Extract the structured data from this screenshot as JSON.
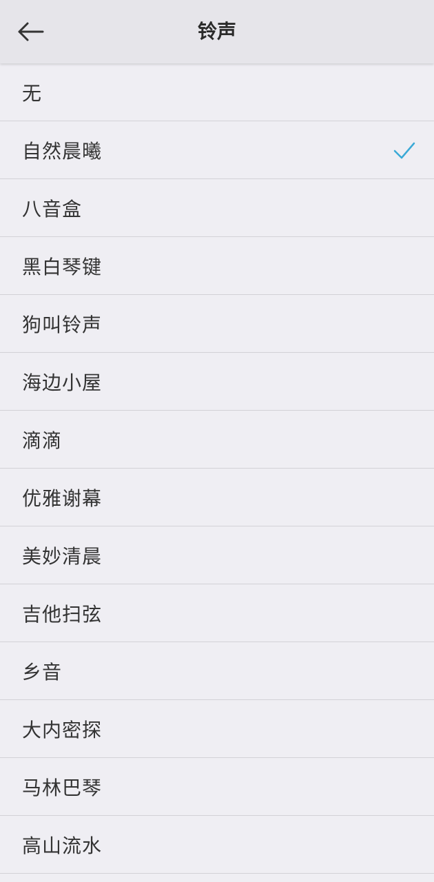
{
  "header": {
    "title": "铃声",
    "back_icon": "arrow-left-icon"
  },
  "accent_color": "#3aa9d6",
  "selected_index": 1,
  "ringtones": [
    {
      "label": "无"
    },
    {
      "label": "自然晨曦"
    },
    {
      "label": "八音盒"
    },
    {
      "label": "黑白琴键"
    },
    {
      "label": "狗叫铃声"
    },
    {
      "label": "海边小屋"
    },
    {
      "label": "滴滴"
    },
    {
      "label": "优雅谢幕"
    },
    {
      "label": "美妙清晨"
    },
    {
      "label": "吉他扫弦"
    },
    {
      "label": "乡音"
    },
    {
      "label": "大内密探"
    },
    {
      "label": "马林巴琴"
    },
    {
      "label": "高山流水"
    }
  ]
}
